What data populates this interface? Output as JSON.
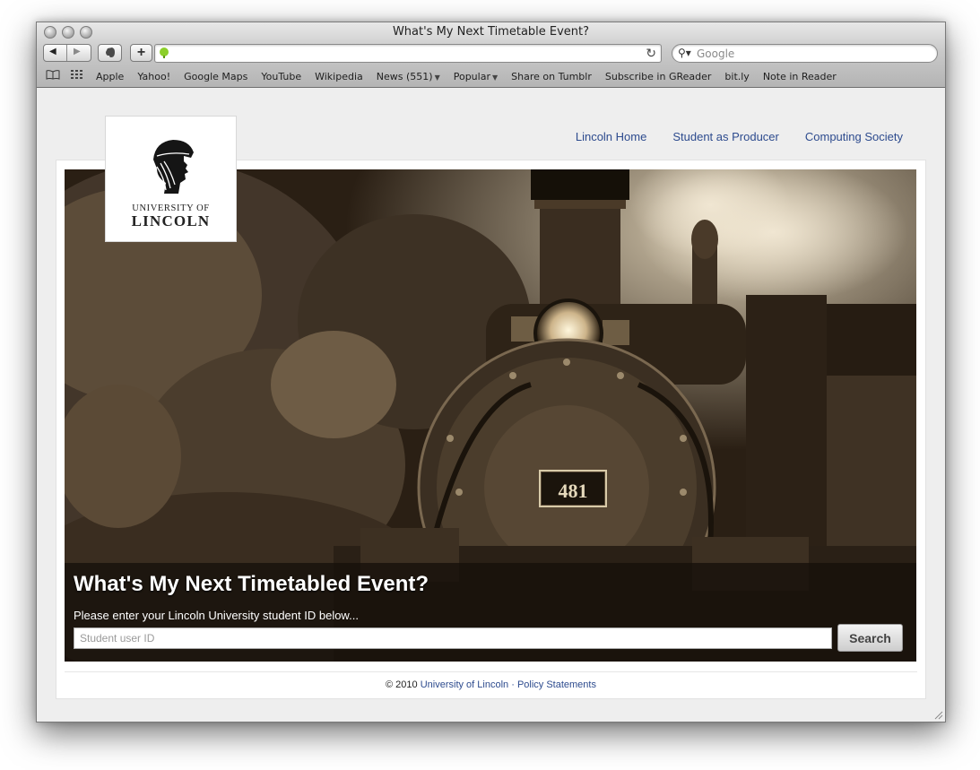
{
  "window": {
    "title": "What's My Next Timetable Event?"
  },
  "toolbar": {
    "search_placeholder": "Google",
    "url_value": ""
  },
  "bookmarks": [
    "Apple",
    "Yahoo!",
    "Google Maps",
    "YouTube",
    "Wikipedia",
    "News (551)",
    "Popular",
    "Share on Tumblr",
    "Subscribe in GReader",
    "bit.ly",
    "Note in Reader"
  ],
  "site": {
    "logo": {
      "line1": "UNIVERSITY OF",
      "line2": "LINCOLN"
    },
    "nav": [
      "Lincoln Home",
      "Student as Producer",
      "Computing Society"
    ],
    "hero": {
      "title": "What's My Next Timetabled Event?",
      "subtitle": "Please enter your Lincoln University student ID below...",
      "input_placeholder": "Student user ID",
      "button": "Search",
      "engine_plate": "481"
    },
    "footer": {
      "prefix": "© 2010 ",
      "link1": "University of Lincoln",
      "sep": " · ",
      "link2": "Policy Statements"
    }
  },
  "colors": {
    "link": "#2d4b8e",
    "hero_tint": "#8a7350"
  }
}
